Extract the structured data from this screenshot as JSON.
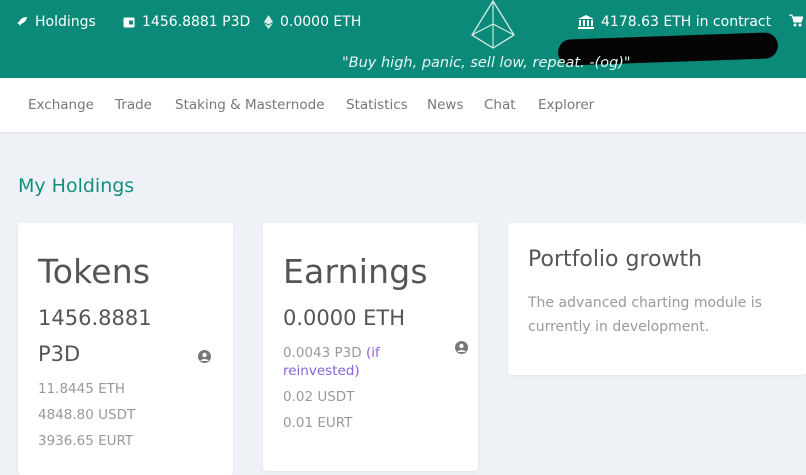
{
  "header": {
    "holdings_label": "Holdings",
    "wallet_value": "1456.8881 P3D",
    "eth_value": "0.0000 ETH",
    "contract_value": "4178.63 ETH in contract",
    "tagline": "\"Buy high, panic, sell low, repeat. -(og)\""
  },
  "nav": {
    "items": [
      "Exchange",
      "Trade",
      "Staking & Masternode",
      "Statistics",
      "News",
      "Chat",
      "Explorer"
    ]
  },
  "page": {
    "title": "My Holdings"
  },
  "tokens_card": {
    "heading": "Tokens",
    "amount": "1456.8881",
    "unit": "P3D",
    "eth": "11.8445 ETH",
    "usdt": "4848.80 USDT",
    "eurt": "3936.65 EURT"
  },
  "earnings_card": {
    "heading": "Earnings",
    "amount": "0.0000 ETH",
    "p3d": "0.0043 P3D",
    "reinvest_line1": "(if",
    "reinvest_line2": "reinvested)",
    "usdt": "0.02 USDT",
    "eurt": "0.01 EURT"
  },
  "portfolio_card": {
    "heading": "Portfolio growth",
    "text": "The advanced charting module is currently in development."
  },
  "colors": {
    "header_bg": "#0c8a79",
    "title_color": "#12907e",
    "reinvest_color": "#8a63d2",
    "page_bg": "#eef2f6"
  },
  "icons": [
    "rocket-icon",
    "wallet-icon",
    "ethereum-icon",
    "logo-icon",
    "bank-icon",
    "cart-icon",
    "user-icon"
  ]
}
